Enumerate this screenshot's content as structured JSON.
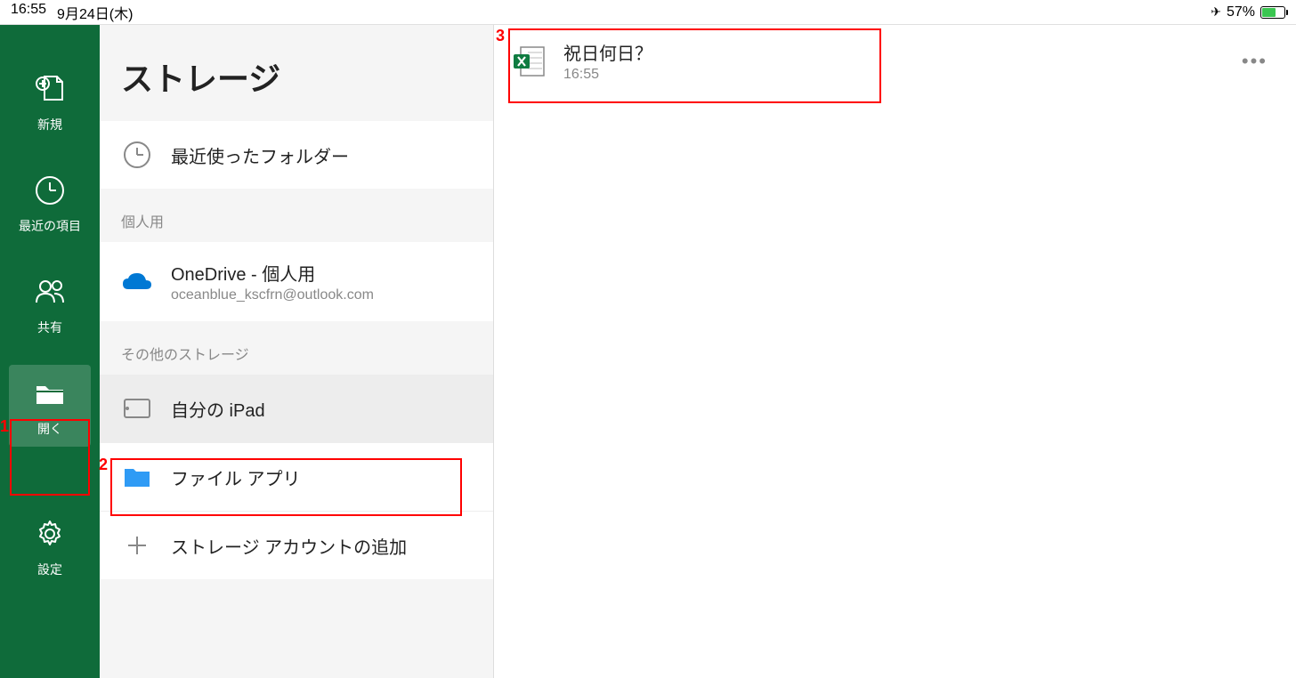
{
  "status_bar": {
    "time": "16:55",
    "date": "9月24日(木)",
    "battery_percent": "57%",
    "airplane_mode": true
  },
  "sidebar": {
    "items": [
      {
        "label": "新規",
        "icon": "new-doc-icon"
      },
      {
        "label": "最近の項目",
        "icon": "clock-icon"
      },
      {
        "label": "共有",
        "icon": "people-icon"
      },
      {
        "label": "開く",
        "icon": "folder-icon",
        "active": true
      },
      {
        "label": "設定",
        "icon": "gear-icon"
      }
    ]
  },
  "storage": {
    "title": "ストレージ",
    "recent_folders_label": "最近使ったフォルダー",
    "section_personal": "個人用",
    "onedrive": {
      "title": "OneDrive - 個人用",
      "email": "oceanblue_kscfrn@outlook.com"
    },
    "section_other": "その他のストレージ",
    "my_ipad": "自分の iPad",
    "files_app": "ファイル アプリ",
    "add_storage": "ストレージ アカウントの追加"
  },
  "files": [
    {
      "name": "祝日何日？",
      "time": "16:55"
    }
  ],
  "annotations": {
    "num1": "1",
    "num2": "2",
    "num3": "3"
  },
  "colors": {
    "brand_green": "#0f6b3a",
    "excel_green": "#107c41",
    "onedrive_blue": "#0078d4",
    "folder_blue": "#2f9bf5"
  }
}
